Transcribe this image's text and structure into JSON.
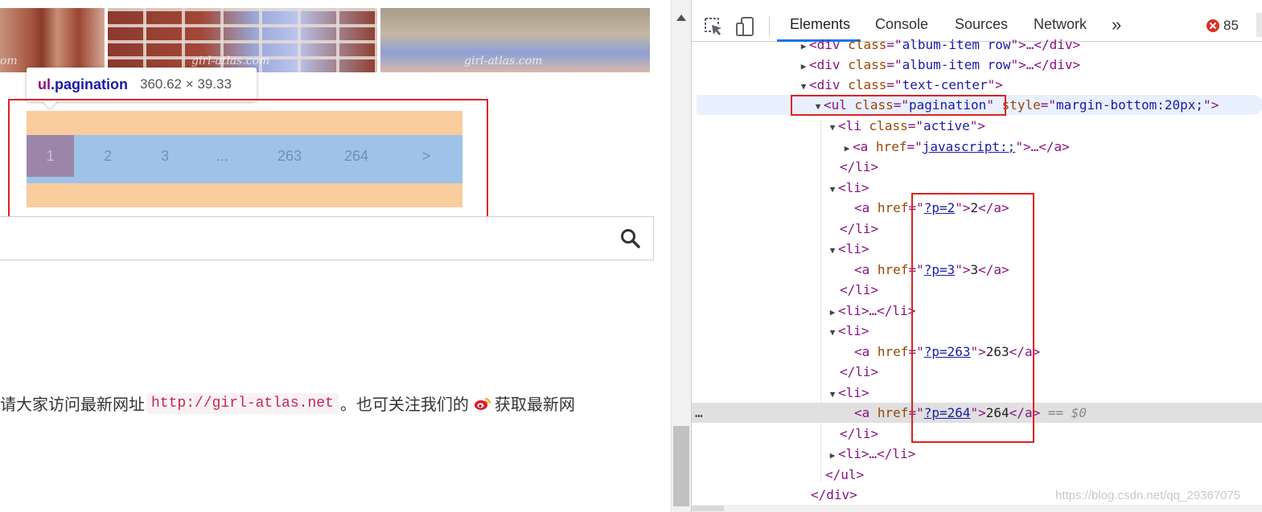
{
  "page": {
    "watermark_text": "girl-atlas.com",
    "tooltip": {
      "selector_tag": "ul",
      "selector_class": ".pagination",
      "dimensions": "360.62 × 39.33"
    },
    "pagination": [
      "1",
      "2",
      "3",
      "...",
      "263",
      "264",
      ">"
    ],
    "active_page": "1",
    "search": {
      "icon": "search-icon"
    },
    "notice": {
      "before": "请大家访问最新网址",
      "url": "http://girl-atlas.net",
      "middle": "。也可关注我们的",
      "icon": "weibo-icon",
      "after": "获取最新网"
    }
  },
  "devtools": {
    "tabs": [
      "Elements",
      "Console",
      "Sources",
      "Network"
    ],
    "active_tab": "Elements",
    "more_tabs_label": "»",
    "error_count": "85",
    "tool_icons": [
      "inspect-element-icon",
      "device-toggle-icon"
    ],
    "dom": {
      "l0": {
        "tag": "div",
        "attr": "class",
        "val": "album-item row",
        "tail": ">…</div>"
      },
      "l1": {
        "tag": "div",
        "attr": "class",
        "val": "album-item row",
        "tail": ">…</div>"
      },
      "l2": {
        "tag": "div",
        "attr": "class",
        "val": "text-center",
        "tail": ">"
      },
      "l3": {
        "tag": "ul",
        "attr": "class",
        "val": "pagination",
        "attr2": "style",
        "val2": "margin-bottom:20px;",
        "tail": ">"
      },
      "l4": {
        "tag": "li",
        "attr": "class",
        "val": "active",
        "tail": ">"
      },
      "l5": {
        "tag": "a",
        "attr": "href",
        "val": "javascript:;",
        "tail": ">…</a>"
      },
      "l6": {
        "close": "</li>"
      },
      "l7": {
        "open": "<li>"
      },
      "l8": {
        "attr": "href",
        "val": "?p=2",
        "text": "2"
      },
      "l9": {
        "close": "</li>"
      },
      "l10": {
        "open": "<li>"
      },
      "l11": {
        "attr": "href",
        "val": "?p=3",
        "text": "3"
      },
      "l12": {
        "close": "</li>"
      },
      "l13": {
        "text": "<li>…</li>"
      },
      "l14": {
        "open": "<li>"
      },
      "l15": {
        "attr": "href",
        "val": "?p=263",
        "text": "263"
      },
      "l16": {
        "close": "</li>"
      },
      "l17": {
        "open": "<li>"
      },
      "l18": {
        "attr": "href",
        "val": "?p=264",
        "text": "264",
        "suffix": "== $0"
      },
      "l19": {
        "close": "</li>"
      },
      "l20": {
        "text": "<li>…</li>"
      },
      "l21": {
        "close": "</ul>"
      },
      "l22": {
        "close": "</div>"
      }
    },
    "selected_dots": "…",
    "watermark": "https://blog.csdn.net/qq_29367075"
  },
  "colors": {
    "highlight_margin": "#f6b26b",
    "highlight_content": "#9fc3e8",
    "annotation_red": "#e02020",
    "tab_underline": "#1a73e8",
    "error_red": "#d93025"
  }
}
